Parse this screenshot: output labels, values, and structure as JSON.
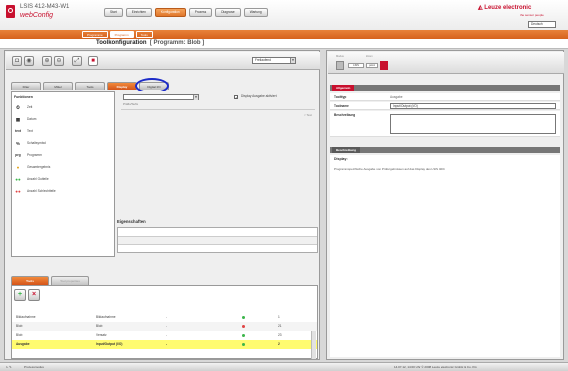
{
  "header": {
    "device": "LSIS 412-M43-W1",
    "app": "webConfig",
    "brand": "Leuze electronic",
    "brand_sub": "the sensor people",
    "language": "Deutsch"
  },
  "nav": [
    "Start",
    "Einrichten",
    "Konfiguration",
    "Prozess",
    "Diagnose",
    "Wartung"
  ],
  "subnav": [
    "Programme",
    "Programm",
    "Tools"
  ],
  "page_title": "Toolkonfiguration",
  "page_program": "[ Programm: Blob ]",
  "trigger": "Freilaufend",
  "tabs": [
    "Filter",
    "Mittel",
    "Tools",
    "Display",
    "Digital I/O"
  ],
  "functions": {
    "header": "Funktionen",
    "items": [
      {
        "icon": "⏲",
        "label": "Zeit"
      },
      {
        "icon": "▦",
        "label": "Datum"
      },
      {
        "icon": "text",
        "label": "Text"
      },
      {
        "icon": "%",
        "label": "Schaltsymbol"
      },
      {
        "icon": "prg",
        "label": "Programm"
      },
      {
        "icon": "●",
        "label": "Gesamtergebnis"
      },
      {
        "icon": "●●",
        "label": "Anzahl Gutteile"
      },
      {
        "icon": "●●",
        "label": "Anzahl Schlechtteile"
      }
    ]
  },
  "props": {
    "checkbox_label": "Display Ausgabe aktiviert",
    "label_small": "Präfix/Sufix",
    "area_text": "< Text",
    "eigenschaften": "Eigenschaften"
  },
  "bottom": {
    "tabs": [
      "Tools",
      "Tool properties"
    ],
    "rows": [
      {
        "name": "Bildaufnahme",
        "type": "Bildaufnahme",
        "dash": "-",
        "color": "#3bb54a",
        "num": "1"
      },
      {
        "name": "Blob",
        "type": "Blob",
        "dash": "-",
        "color": "#e04545",
        "num": "21"
      },
      {
        "name": "Blob",
        "type": "Versatz",
        "dash": "-",
        "color": "#3bb54a",
        "num": "23"
      },
      {
        "name": "Ausgabe",
        "type": "Input/Output (I/O)",
        "dash": "-",
        "color": "#3bb54a",
        "num": "2"
      }
    ]
  },
  "right": {
    "top_label1": "Modus",
    "top_label2": "Zoom",
    "box1": "LSIS",
    "box2": "pos1",
    "header1": "Allgemein",
    "rows": [
      {
        "k": "Toolttyp",
        "v": "Ausgabe"
      },
      {
        "k": "Toolname",
        "v": "Input/Output (I/O)"
      }
    ],
    "beschreibung": "Beschreibung",
    "header2": "Beschreibung",
    "desc_title": "Display:",
    "desc_text": "Programmspezifische Ausgabe von Prüfergebnissen auf das Display des LSIS 400i"
  },
  "status": {
    "left": "Prozessmodus",
    "right": "14.07.12, 14:00 Uhr  © 2008 Leuze electronic GmbH & Co. KG"
  }
}
